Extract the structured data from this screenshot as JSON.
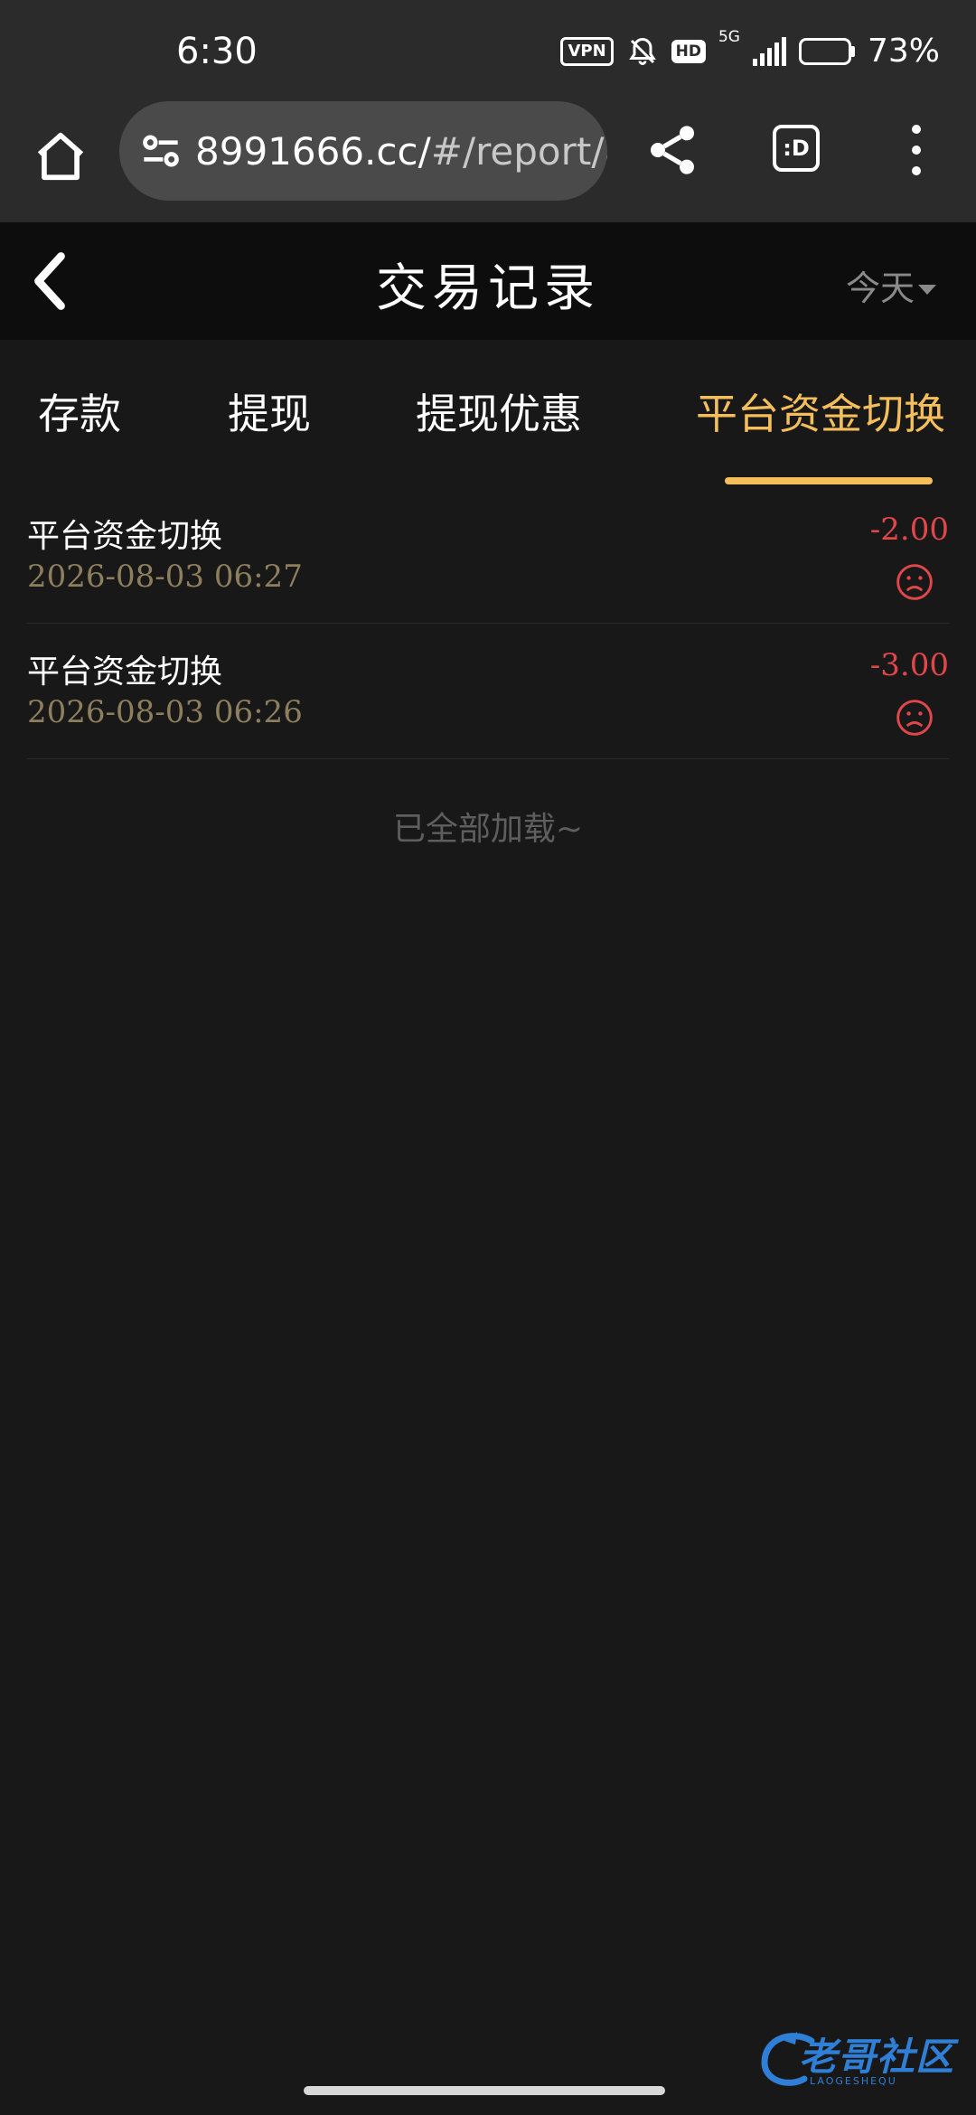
{
  "status_bar": {
    "time": "6:30",
    "vpn": "VPN",
    "hd": "HD",
    "network": "5G",
    "battery": "73%",
    "battery_level": 0.73
  },
  "browser": {
    "url_main": "8991666.cc/",
    "url_rest": "#/report/a",
    "tab_glyph": ":D",
    "icons": [
      "home-icon",
      "site-settings-icon",
      "share-icon",
      "tab-switcher-icon",
      "more-vert-icon"
    ]
  },
  "header": {
    "title": "交易记录",
    "filter_label": "今天"
  },
  "tabs": [
    {
      "label": "存款",
      "active": false
    },
    {
      "label": "提现",
      "active": false
    },
    {
      "label": "提现优惠",
      "active": false
    },
    {
      "label": "平台资金切换",
      "active": true
    }
  ],
  "records": [
    {
      "name": "平台资金切换",
      "date": "2026-08-03 06:27",
      "amount": "-2.00",
      "status_icon": "sad-face-icon"
    },
    {
      "name": "平台资金切换",
      "date": "2026-08-03 06:26",
      "amount": "-3.00",
      "status_icon": "sad-face-icon"
    }
  ],
  "footer_text": "已全部加载~",
  "watermark": {
    "text": "老哥社区",
    "sub": "LAOGESHEQU"
  },
  "colors": {
    "accent": "#f4be5a",
    "negative": "#e0474a",
    "date": "#8e7f5c",
    "background": "#181818"
  }
}
